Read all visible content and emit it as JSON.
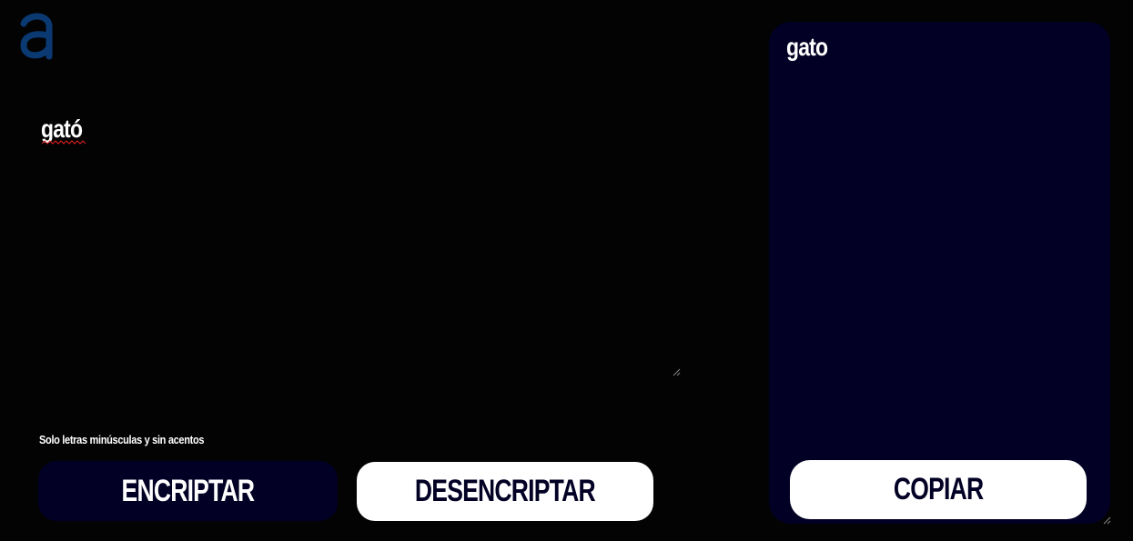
{
  "logo": {
    "icon": "letter-a-logo-icon",
    "color": "#0b3a73"
  },
  "input": {
    "value": "gató"
  },
  "hint": {
    "text": "Solo letras minúsculas y sin acentos"
  },
  "buttons": {
    "encrypt_label": "ENCRIPTAR",
    "decrypt_label": "DESENCRIPTAR",
    "copy_label": "COPIAR"
  },
  "output": {
    "value": "gato"
  },
  "colors": {
    "background": "#030303",
    "panel": "#020024",
    "button_light": "#ffffff",
    "text_dark": "#020024",
    "spellcheck": "#e02020"
  }
}
